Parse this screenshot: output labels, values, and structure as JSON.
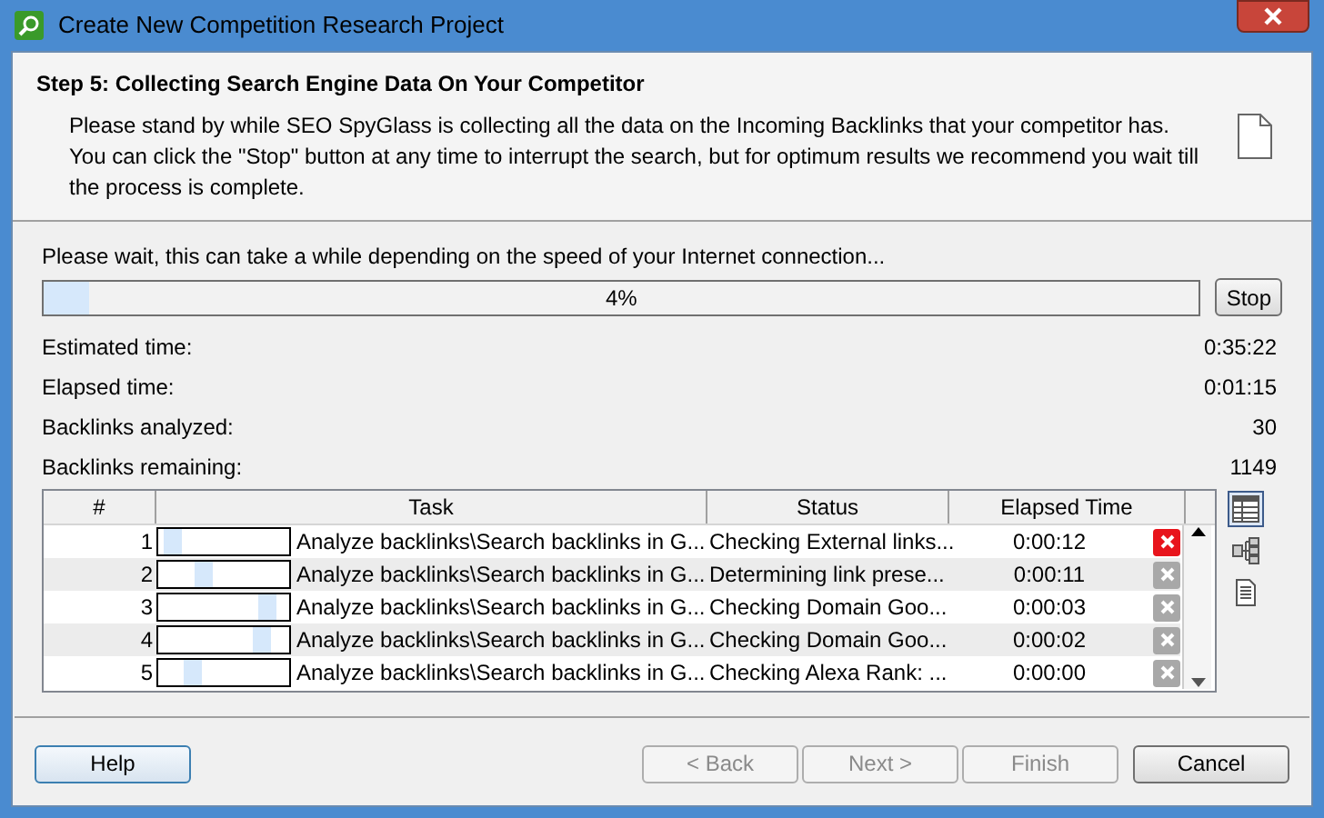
{
  "window": {
    "title": "Create New Competition Research Project"
  },
  "header": {
    "title": "Step 5: Collecting Search Engine Data On Your Competitor",
    "description": "Please stand by while SEO SpyGlass is collecting all the data on the Incoming Backlinks that your competitor has. You can click the \"Stop\" button at any time to interrupt the search, but for optimum results we recommend you wait till the process is complete."
  },
  "progress": {
    "message": "Please wait, this can take a while depending on the speed of your Internet connection...",
    "level": 0.04,
    "reading": "4%",
    "stop_button": "Stop"
  },
  "stats": [
    {
      "label": "Estimated time:",
      "value": "0:35:22"
    },
    {
      "label": "Elapsed time:",
      "value": "0:01:15"
    },
    {
      "label": "Backlinks analyzed:",
      "value": "30"
    },
    {
      "label": "Backlinks remaining:",
      "value": "1149"
    }
  ],
  "table": {
    "columns": [
      "#",
      "Task",
      "Status",
      "Elapsed Time"
    ],
    "rows": [
      {
        "number": "1",
        "level": 0.05,
        "task": "Analyze backlinks\\Search backlinks in G...",
        "status": "Checking External links...",
        "elapsed": "0:00:12",
        "active": true
      },
      {
        "number": "2",
        "level": 0.33,
        "task": "Analyze backlinks\\Search backlinks in G...",
        "status": "Determining link prese...",
        "elapsed": "0:00:11",
        "active": false
      },
      {
        "number": "3",
        "level": 0.88,
        "task": "Analyze backlinks\\Search backlinks in G...",
        "status": "Checking Domain Goo...",
        "elapsed": "0:00:03",
        "active": false
      },
      {
        "number": "4",
        "level": 0.84,
        "task": "Analyze backlinks\\Search backlinks in G...",
        "status": "Checking Domain Goo...",
        "elapsed": "0:00:02",
        "active": false
      },
      {
        "number": "5",
        "level": 0.23,
        "task": "Analyze backlinks\\Search backlinks in G...",
        "status": "Checking Alexa Rank: ...",
        "elapsed": "0:00:00",
        "active": false
      }
    ]
  },
  "views": [
    {
      "kind": "table",
      "selected": true
    },
    {
      "kind": "tree",
      "selected": false
    },
    {
      "kind": "document",
      "selected": false
    }
  ],
  "buttons": [
    {
      "label": "Help",
      "disabled": false
    },
    {
      "label": "< Back",
      "disabled": true
    },
    {
      "label": "Next >",
      "disabled": true
    },
    {
      "label": "Finish",
      "disabled": true
    },
    {
      "label": "Cancel",
      "disabled": false
    }
  ]
}
